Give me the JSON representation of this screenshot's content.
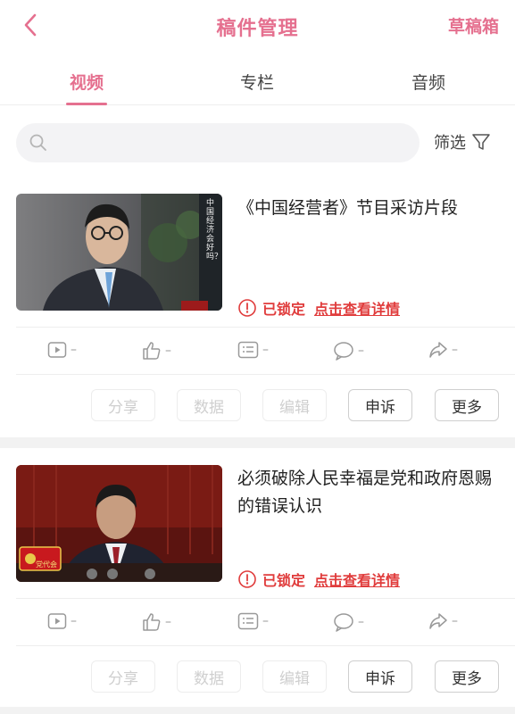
{
  "navbar": {
    "title": "稿件管理",
    "right_label": "草稿箱",
    "back_icon": "chevron-left-icon",
    "accent": "#e5708f"
  },
  "tabs": [
    {
      "label": "视频",
      "active": true
    },
    {
      "label": "专栏",
      "active": false
    },
    {
      "label": "音频",
      "active": false
    }
  ],
  "search": {
    "placeholder": "",
    "value": ""
  },
  "filter": {
    "label": "筛选",
    "icon": "funnel-icon"
  },
  "items": [
    {
      "title": "《中国经营者》节目采访片段",
      "status_text": "已锁定",
      "details_link": "点击查看详情",
      "thumb_caption": "中国经济会好吗？",
      "stats": {
        "plays": "–",
        "likes": "–",
        "comments": "–",
        "danmaku": "–",
        "shares": "–"
      },
      "actions": {
        "share": "分享",
        "data": "数据",
        "edit": "编辑",
        "appeal": "申诉",
        "more": "更多"
      }
    },
    {
      "title": "必须破除人民幸福是党和政府恩赐的错误认识",
      "status_text": "已锁定",
      "details_link": "点击查看详情",
      "thumb_caption": "党代会",
      "stats": {
        "plays": "–",
        "likes": "–",
        "comments": "–",
        "danmaku": "–",
        "shares": "–"
      },
      "actions": {
        "share": "分享",
        "data": "数据",
        "edit": "编辑",
        "appeal": "申诉",
        "more": "更多"
      }
    }
  ],
  "colors": {
    "accent": "#e5708f",
    "danger": "#e03c3c",
    "muted": "#999999"
  }
}
